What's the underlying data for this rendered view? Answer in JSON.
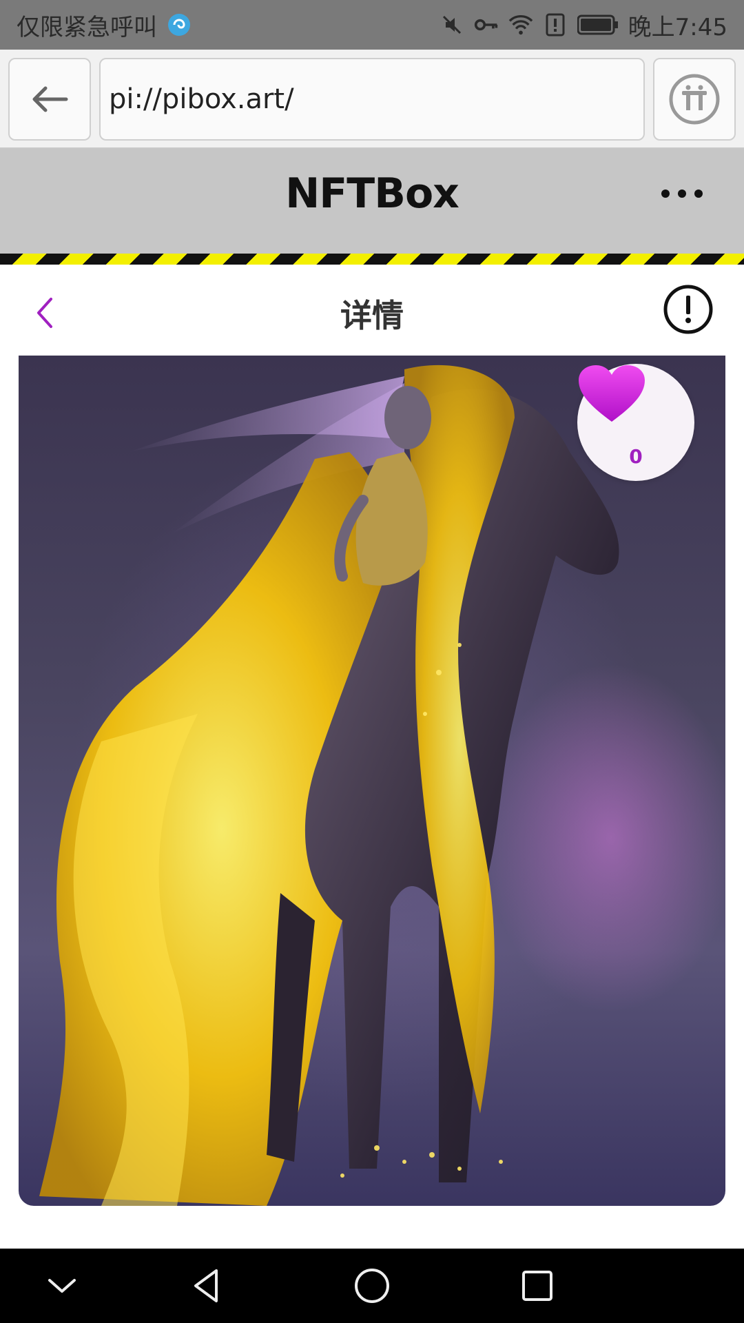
{
  "status_bar": {
    "left_text": "仅限紧急呼叫",
    "time": "晚上7:45",
    "icons": [
      "assistant-icon",
      "mute-icon",
      "key-icon",
      "wifi-icon",
      "alert-icon",
      "battery-icon"
    ]
  },
  "browser": {
    "url": "pi://pibox.art/",
    "back_icon": "arrow-left-icon",
    "pi_icon": "pi-logo-icon"
  },
  "app": {
    "title": "NFTBox",
    "more_icon": "more-dots-icon"
  },
  "detail": {
    "title": "详情",
    "back_icon": "chevron-left-icon",
    "info_icon": "info-circle-icon"
  },
  "artwork": {
    "like_count": "0",
    "like_icon": "heart-icon"
  },
  "nav": {
    "icons": [
      "collapse-icon",
      "back-icon",
      "home-icon",
      "recents-icon"
    ]
  },
  "colors": {
    "accent": "#a020c0",
    "header_bg": "#c6c6c6",
    "hazard_yellow": "#f3ef00"
  }
}
